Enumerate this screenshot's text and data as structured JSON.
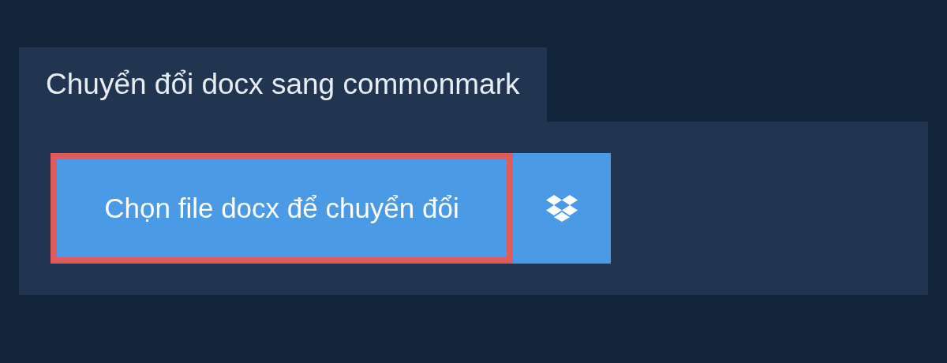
{
  "title": "Chuyển đổi docx sang commonmark",
  "upload_button": {
    "label": "Chọn file docx để chuyển đổi",
    "focused": true
  }
}
